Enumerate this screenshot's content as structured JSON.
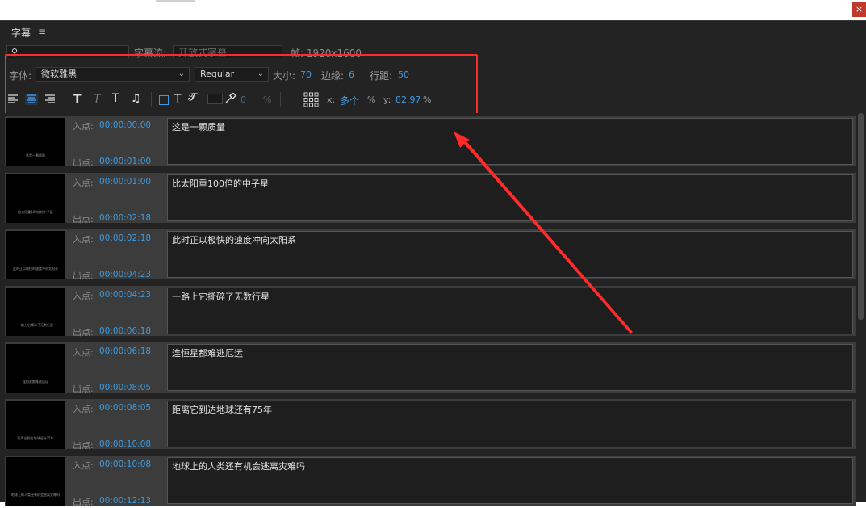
{
  "window": {
    "close_glyph": "×"
  },
  "panel": {
    "title": "字幕",
    "menu_glyph": "≡"
  },
  "toolbar": {
    "search_icon": "search-icon",
    "stream_label": "字幕流:",
    "stream_value": "开放式字幕",
    "frame_label": "帧: 1920x1600",
    "font_label": "字体:",
    "font_value": "微软雅黑",
    "style_value": "Regular",
    "size_label": "大小:",
    "size_value": "70",
    "edge_label": "边缘:",
    "edge_value": "6",
    "line_label": "行距:",
    "line_value": "50",
    "opacity_value": "0",
    "percent": "%",
    "x_label": "x:",
    "x_value": "多个",
    "y_label": "y:",
    "y_value": "82.97"
  },
  "labels": {
    "in": "入点:",
    "out": "出点:"
  },
  "captions": [
    {
      "in": "00:00:00:00",
      "out": "00:00:01:00",
      "text": "这是一颗质量",
      "thumb": "这是一颗质量"
    },
    {
      "in": "00:00:01:00",
      "out": "00:00:02:18",
      "text": "比太阳重100倍的中子星",
      "thumb": "比太阳重100倍的中子星"
    },
    {
      "in": "00:00:02:18",
      "out": "00:00:04:23",
      "text": "此时正以极快的速度冲向太阳系",
      "thumb": "此时正以极快的速度冲向太阳系"
    },
    {
      "in": "00:00:04:23",
      "out": "00:00:06:18",
      "text": "一路上它撕碎了无数行星",
      "thumb": "一路上它撕碎了无数行星"
    },
    {
      "in": "00:00:06:18",
      "out": "00:00:08:05",
      "text": "连恒星都难逃厄运",
      "thumb": "连恒星都难逃厄运"
    },
    {
      "in": "00:00:08:05",
      "out": "00:00:10:08",
      "text": "距离它到达地球还有75年",
      "thumb": "距离它到达地球还有75年"
    },
    {
      "in": "00:00:10:08",
      "out": "00:00:12:13",
      "text": "地球上的人类还有机会逃离灾难吗",
      "thumb": "地球上的人类还有机会逃离灾难吗"
    }
  ],
  "colors": {
    "accent": "#3e9ae0",
    "highlight": "#ff2a2a"
  }
}
